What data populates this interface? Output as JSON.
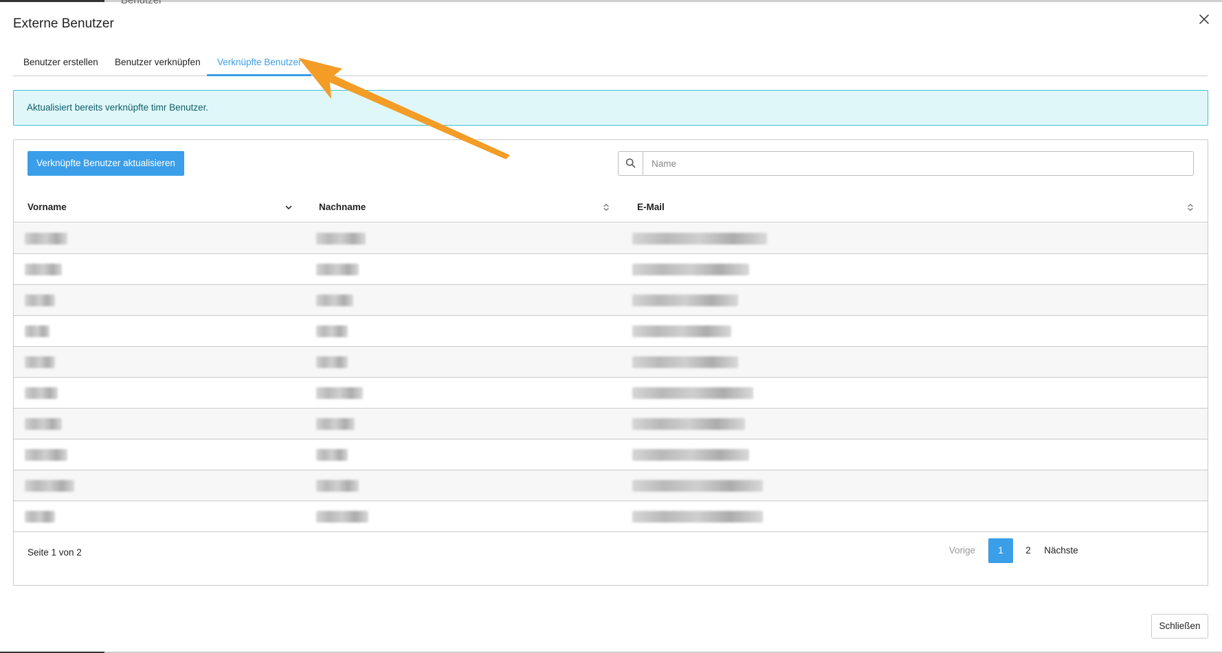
{
  "background": {
    "behind_text": "Benutzer"
  },
  "modal": {
    "title": "Externe Benutzer",
    "close_icon": "close-icon"
  },
  "tabs": [
    {
      "label": "Benutzer erstellen",
      "active": false
    },
    {
      "label": "Benutzer verknüpfen",
      "active": false
    },
    {
      "label": "Verknüpfte Benutzer",
      "active": true
    }
  ],
  "info_alert": {
    "text": "Aktualisiert bereits verknüpfte timr Benutzer."
  },
  "toolbar": {
    "refresh_label": "Verknüpfte Benutzer aktualisieren",
    "search_icon": "search-icon",
    "search_placeholder": "Name",
    "search_value": ""
  },
  "table": {
    "columns": [
      {
        "label": "Vorname",
        "sort_icon": "chevron-down-icon"
      },
      {
        "label": "Nachname",
        "sort_icon": "sort-icon"
      },
      {
        "label": "E-Mail",
        "sort_icon": "sort-icon"
      }
    ],
    "rows_note": "cell contents are pixelated / obscured in the screenshot",
    "row_count": 10
  },
  "footer": {
    "page_info": "Seite 1 von 2",
    "pagination": {
      "prev_label": "Vorige",
      "pages": [
        "1",
        "2"
      ],
      "current": "1",
      "next_label": "Nächste"
    }
  },
  "dialog_actions": {
    "close_label": "Schließen"
  },
  "colors": {
    "accent": "#3a9ee8",
    "info_bg": "#e0f7fa",
    "info_border": "#3cc0cf",
    "annotation_arrow": "#f39c26"
  }
}
